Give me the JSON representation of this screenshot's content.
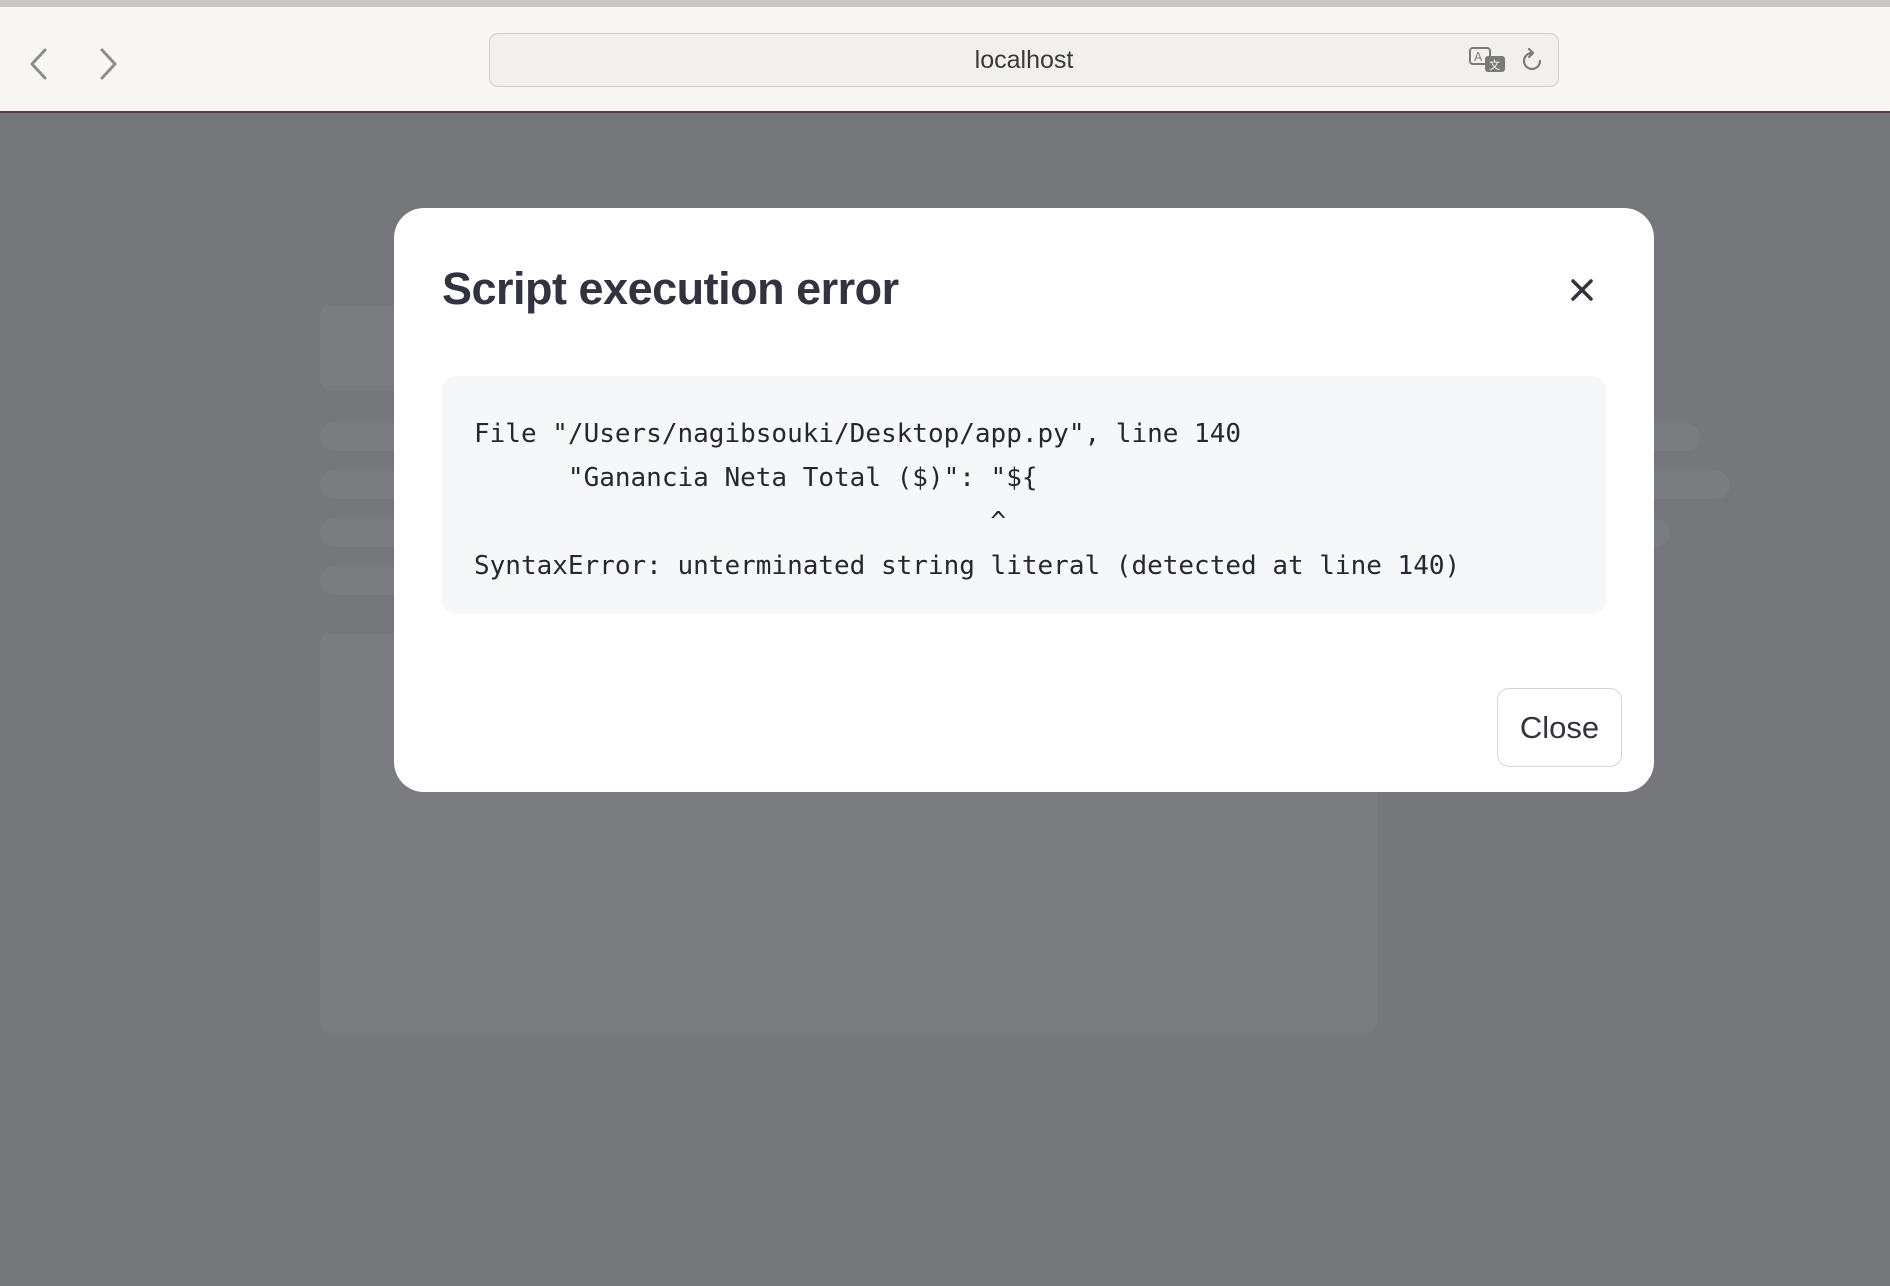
{
  "browser": {
    "address": "localhost",
    "back_icon": "chevron-left-icon",
    "forward_icon": "chevron-right-icon",
    "translate_icon": "translate-icon",
    "reload_icon": "reload-icon"
  },
  "modal": {
    "title": "Script execution error",
    "close_icon": "close-icon",
    "code_lines": [
      "File \"/Users/nagibsouki/Desktop/app.py\", line 140",
      "      \"Ganancia Neta Total ($)\": \"${",
      "                                 ^",
      "SyntaxError: unterminated string literal (detected at line 140)"
    ],
    "close_button_label": "Close"
  },
  "colors": {
    "overlay": "#76777b",
    "modal_bg": "#ffffff",
    "code_bg": "#f6f7f9",
    "text": "#31333f"
  }
}
